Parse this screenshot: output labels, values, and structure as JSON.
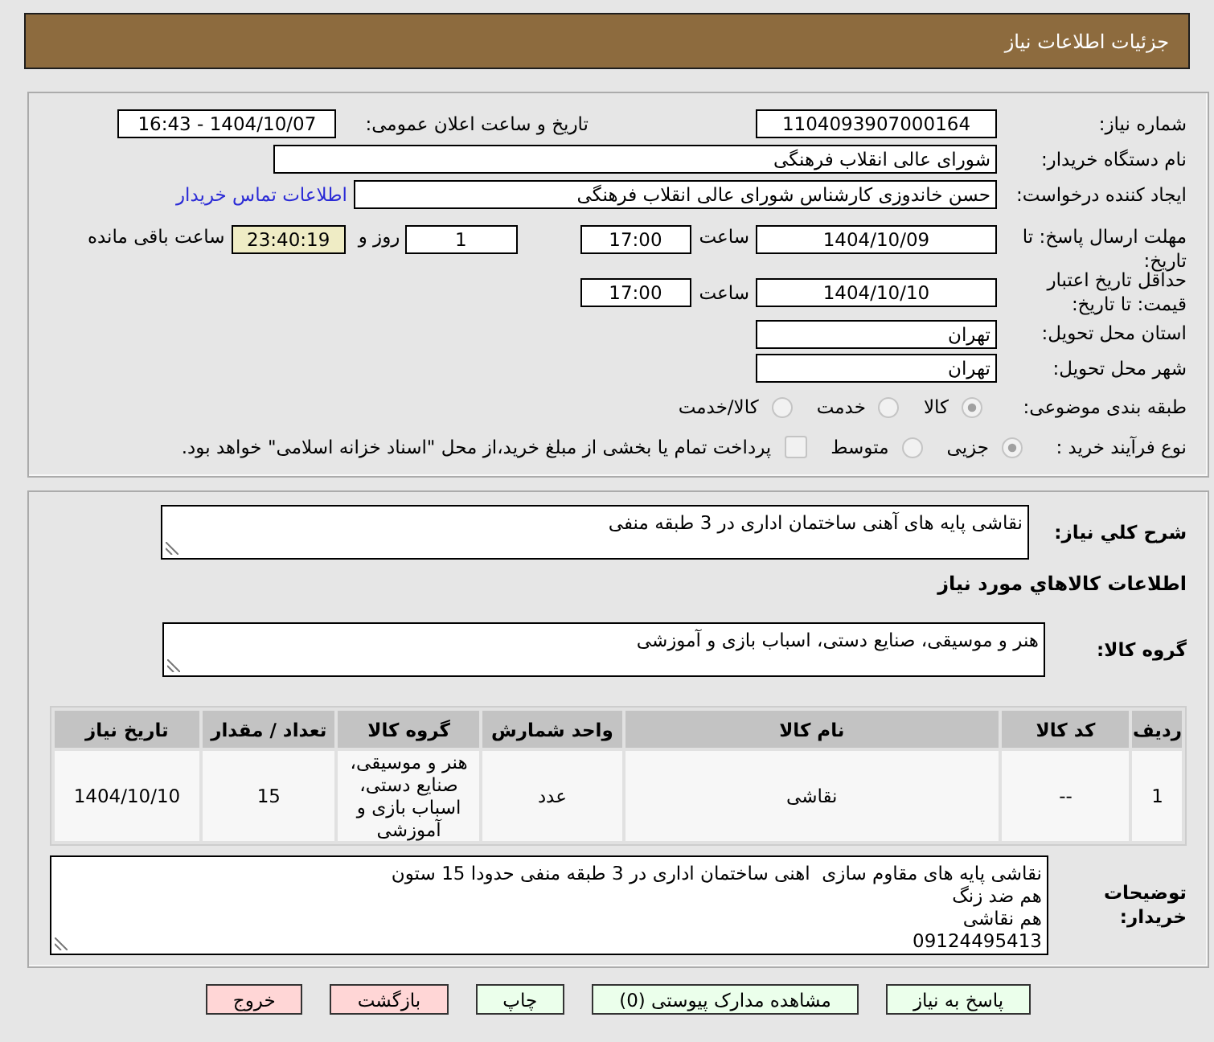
{
  "header": {
    "title": "جزئیات اطلاعات نیاز"
  },
  "details": {
    "need_number": {
      "label": "شماره نیاز:",
      "value": "1104093907000164"
    },
    "announce_datetime": {
      "label": "تاریخ و ساعت اعلان عمومی:",
      "value": "1404/10/07 - 16:43"
    },
    "buyer_org": {
      "label": "نام دستگاه خریدار:",
      "value": "شورای عالی انقلاب فرهنگی"
    },
    "requester": {
      "label": "ایجاد کننده درخواست:",
      "value": "حسن خاندوزی کارشناس شورای عالی انقلاب فرهنگی",
      "link": "اطلاعات تماس خریدار"
    },
    "reply_deadline": {
      "label": "مهلت ارسال پاسخ: تا تاریخ:",
      "date": "1404/10/09",
      "time_label": "ساعت",
      "time": "17:00",
      "days": "1",
      "days_label": "روز و",
      "remaining": "23:40:19",
      "remaining_label": "ساعت باقی مانده"
    },
    "price_validity": {
      "label": "حداقل تاریخ اعتبار قیمت: تا تاریخ:",
      "date": "1404/10/10",
      "time_label": "ساعت",
      "time": "17:00"
    },
    "delivery_province": {
      "label": "استان محل تحویل:",
      "value": "تهران"
    },
    "delivery_city": {
      "label": "شهر محل تحویل:",
      "value": "تهران"
    },
    "subject_category": {
      "label": "طبقه بندی موضوعی:",
      "options": [
        {
          "label": "کالا",
          "selected": true,
          "disabled": true
        },
        {
          "label": "خدمت",
          "selected": false,
          "disabled": true
        },
        {
          "label": "کالا/خدمت",
          "selected": false,
          "disabled": true
        }
      ]
    },
    "purchase_process": {
      "label": "نوع فرآیند خرید :",
      "options": [
        {
          "label": "جزیی",
          "selected": true,
          "disabled": true
        },
        {
          "label": "متوسط",
          "selected": false,
          "disabled": true
        }
      ],
      "treasury_payment": {
        "label": "پرداخت تمام یا بخشی از مبلغ خرید،از محل \"اسناد خزانه اسلامی\" خواهد بود.",
        "checked": false,
        "disabled": true
      }
    }
  },
  "need_summary": {
    "label": "شرح کلي نياز:",
    "value": "نقاشی پایه های آهنی ساختمان اداری در 3 طبقه منفی"
  },
  "goods_section": {
    "title": "اطلاعات کالاهاي مورد نياز",
    "group_label": "گروه کالا:",
    "group_value": "هنر و موسیقی، صنایع دستی، اسباب بازی و آموزشی"
  },
  "items_table": {
    "columns": [
      "ردیف",
      "کد کالا",
      "نام کالا",
      "واحد شمارش",
      "گروه کالا",
      "تعداد / مقدار",
      "تاریخ نیاز"
    ],
    "rows": [
      [
        "1",
        "--",
        "نقاشی",
        "عدد",
        "هنر و موسیقی، صنایع دستی، اسباب بازی و آموزشی",
        "15",
        "1404/10/10"
      ]
    ]
  },
  "buyer_notes": {
    "label": "توضیحات خریدار:",
    "value": "نقاشی پایه های مقاوم سازی  اهنی ساختمان اداری در 3 طبقه منفی حدودا 15 ستون\nهم ضد زنگ\nهم نقاشی\n09124495413"
  },
  "buttons": [
    {
      "label": "پاسخ به نیاز",
      "kind": "action"
    },
    {
      "label": "مشاهده مدارک پیوستی (0)",
      "kind": "action"
    },
    {
      "label": "چاپ",
      "kind": "action"
    },
    {
      "label": "بازگشت",
      "kind": "cancel"
    },
    {
      "label": "خروج",
      "kind": "cancel"
    }
  ]
}
